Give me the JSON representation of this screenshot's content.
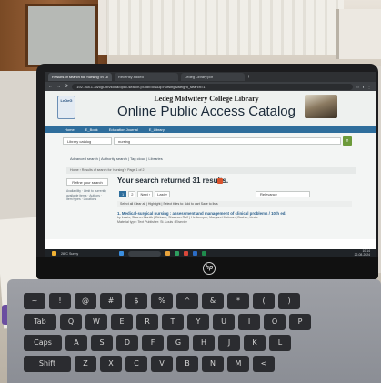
{
  "browser": {
    "tabs": [
      {
        "label": "Results of search for 'nursing' in Lc",
        "active": true
      },
      {
        "label": "Recently added",
        "active": false
      },
      {
        "label": "Ledeg Library.pdf",
        "active": false
      }
    ],
    "url": "192.168.1.38/cgi-bin/koha/opac-search.pl?idx=kw&q=nursing&weight_search=1"
  },
  "catalog": {
    "library_name": "Ledeg Midwifery College  Library",
    "title": "Online Public Access Catalog",
    "logo_text": "LeDeG",
    "nav": [
      "Home",
      "E_Book",
      "Education Journal",
      "E_Library"
    ],
    "search_select": "Library catalog",
    "search_query": "nursing",
    "advanced_links": "Advanced search  |  Authority search  |  Tag cloud  |  Libraries",
    "breadcrumb": "Home › Results of search for 'nursing' › Page 1 of 2",
    "refine_label": "Refine your search",
    "result_count": "Your search returned 31 results.",
    "facets": "Availability · Limit to currently available items · Authors · Item types · Locations",
    "pagination": [
      "1",
      "2",
      "Next ›",
      "Last »"
    ],
    "sort": "Relevance",
    "toolbar": "Select all  Clear all  |  Highlight  |  Select titles to: Add to cart  Save to lists",
    "first_result_title": "1.  Medical-surgical nursing : assessment and management of clinical problems / 10th ed.",
    "first_result_meta": "by Lewis, Sharon Mantik | Dirksen, Shannon Ruff | Heitkemper, Margaret McLean | Bucher, Linda",
    "first_result_meta2": "Material type: Text  Publisher: St. Louis : Elsevier"
  },
  "taskbar": {
    "weather": "28°C Sunny",
    "time": "10:14",
    "date": "22-08-2024"
  },
  "keyboard": {
    "row1": [
      "~",
      "!",
      "@",
      "#",
      "$",
      "%",
      "^",
      "&",
      "*",
      "(",
      ")"
    ],
    "row2": [
      "Tab",
      "Q",
      "W",
      "E",
      "R",
      "T",
      "Y",
      "U",
      "I",
      "O",
      "P"
    ],
    "row3": [
      "Caps",
      "A",
      "S",
      "D",
      "F",
      "G",
      "H",
      "J",
      "K",
      "L"
    ],
    "row4": [
      "Shift",
      "Z",
      "X",
      "C",
      "V",
      "B",
      "N",
      "M",
      "<"
    ]
  },
  "colors": {
    "navbar": "#2f6e9c",
    "search_button": "#6c9a3a",
    "link": "#2a5f8c"
  }
}
